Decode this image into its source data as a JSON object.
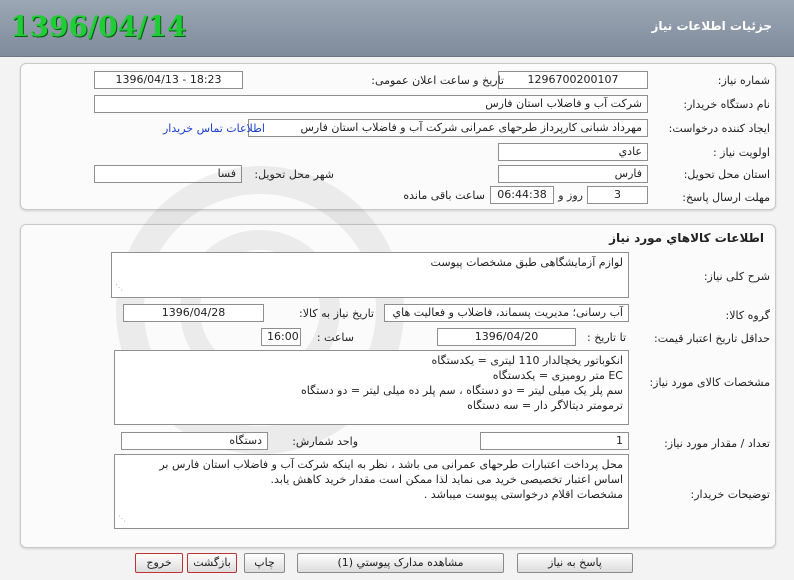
{
  "header": {
    "title": "جزئیات اطلاعات نیاز",
    "date": "1396/04/14"
  },
  "info": {
    "need_number_label": "شماره نیاز:",
    "need_number": "1296700200107",
    "announce_label": "تاریخ و ساعت اعلان عمومی:",
    "announce_value": "1396/04/13 - 18:23",
    "buyer_org_label": "نام دستگاه خریدار:",
    "buyer_org": "شرکت آب و فاضلاب استان فارس",
    "requester_label": "ایجاد کننده درخواست:",
    "requester": "مهرداد شبانی کارپرداز طرحهای عمرانی  شرکت آب و فاضلاب استان فارس",
    "contact_link": "اطلاعات تماس خریدار",
    "priority_label": "اولویت نیاز :",
    "priority": "عادي",
    "province_label": "استان محل تحویل:",
    "province": "فارس",
    "city_label": "شهر محل تحویل:",
    "city": "فسا",
    "deadline_label": "مهلت ارسال پاسخ:",
    "days": "3",
    "day_and": "روز و",
    "time_left": "06:44:38",
    "time_left_suffix": "ساعت باقی مانده"
  },
  "goods": {
    "section_title": "اطلاعات کالاهاي مورد نياز",
    "description_label": "شرح کلی نیاز:",
    "description": "لوازم آزمایشگاهی طبق مشخصات پیوست",
    "group_label": "گروه کالا:",
    "group": "آب رسانی؛ مدیریت پسماند، فاضلاب و فعالیت هاي",
    "need_date_label": "تاریخ نیاز به کالا:",
    "need_date": "1396/04/28",
    "min_price_label": "حداقل تاریخ اعتبار قیمت:",
    "until_label": "تا تاریخ :",
    "price_date": "1396/04/20",
    "hour_label": "ساعت :",
    "hour": "16:00",
    "specs_label": "مشخصات کالای مورد نیاز:",
    "specs": [
      "انکوباتور یخچالدار 110 لیتری = یکدستگاه",
      "EC متر رومیزی = یکدستگاه",
      "سم پلر یک میلی لیتر = دو دستگاه ،  سم پلر ده میلی لیتر = دو دستگاه",
      "ترمومتر دیتالاگر دار = سه دستگاه"
    ],
    "qty_label": "تعداد / مقدار مورد نیاز:",
    "qty": "1",
    "unit_label": "واحد شمارش:",
    "unit": "دستگاه",
    "buyer_notes_label": "توضیحات خریدار:",
    "buyer_notes": [
      "محل پرداخت اعتبارات طرحهای عمرانی می باشد ، نظر به اینکه شرکت آب و فاضلاب استان فارس بر",
      "اساس اعتبار تخصیصی خرید می نماید لذا ممکن است مقدار خرید کاهش یابد.",
      "مشخصات اقلام درخواستی پیوست میباشد ."
    ]
  },
  "buttons": {
    "reply": "پاسخ به نیاز",
    "attachments": "مشاهده مدارک پیوستي (1)",
    "print": "چاپ",
    "back": "بازگشت",
    "exit": "خروج"
  }
}
